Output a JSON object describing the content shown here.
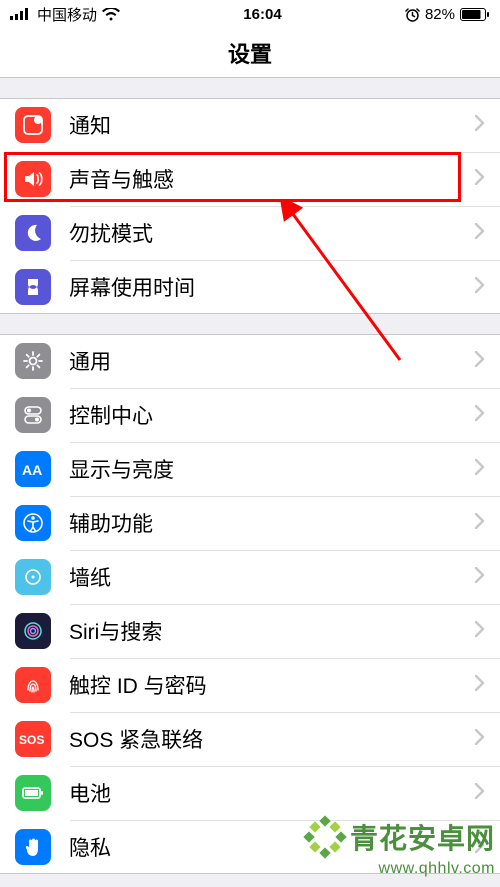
{
  "status": {
    "carrier": "中国移动",
    "time": "16:04",
    "battery": "82%"
  },
  "header": {
    "title": "设置"
  },
  "groups": [
    {
      "rows": [
        {
          "label": "通知"
        },
        {
          "label": "声音与触感"
        },
        {
          "label": "勿扰模式"
        },
        {
          "label": "屏幕使用时间"
        }
      ]
    },
    {
      "rows": [
        {
          "label": "通用"
        },
        {
          "label": "控制中心"
        },
        {
          "label": "显示与亮度"
        },
        {
          "label": "辅助功能"
        },
        {
          "label": "墙纸"
        },
        {
          "label": "Siri与搜索"
        },
        {
          "label": "触控 ID 与密码"
        },
        {
          "label": "SOS 紧急联络"
        },
        {
          "label": "电池"
        },
        {
          "label": "隐私"
        }
      ]
    }
  ],
  "watermark": {
    "brand": "青花安卓网",
    "url": "www.qhhlv.com"
  }
}
